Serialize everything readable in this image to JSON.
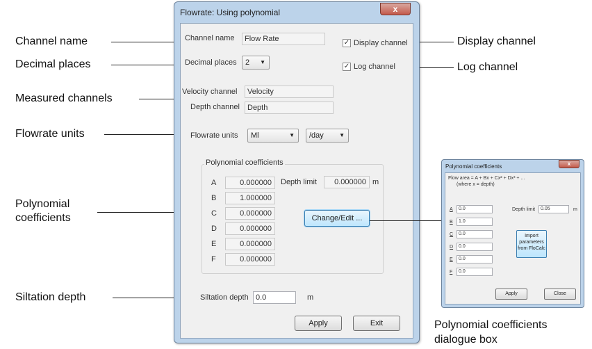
{
  "callouts": {
    "channel_name": "Channel name",
    "decimal_places": "Decimal places",
    "measured_channels": "Measured channels",
    "flowrate_units": "Flowrate units",
    "polynomial_coefficients": [
      "Polynomial",
      "coefficients"
    ],
    "siltation_depth": "Siltation depth",
    "display_channel": "Display channel",
    "log_channel": "Log channel",
    "dialogue_caption": [
      "Polynomial coefficients",
      "dialogue box"
    ]
  },
  "main_dialog": {
    "title": "Flowrate: Using polynomial",
    "close_label": "x",
    "channel_name_label": "Channel name",
    "channel_name_value": "Flow Rate",
    "decimal_places_label": "Decimal places",
    "decimal_places_value": "2",
    "display_channel_label": "Display channel",
    "display_channel_checked": true,
    "log_channel_label": "Log channel",
    "log_channel_checked": true,
    "velocity_channel_label": "Velocity channel",
    "velocity_channel_value": "Velocity",
    "depth_channel_label": "Depth channel",
    "depth_channel_value": "Depth",
    "flowrate_units_label": "Flowrate units",
    "flowrate_unit_value": "Ml",
    "flowrate_period_value": "/day",
    "poly_group_label": "Polynomial coefficients",
    "coefficients": [
      {
        "letter": "A",
        "value": "0.000000"
      },
      {
        "letter": "B",
        "value": "1.000000"
      },
      {
        "letter": "C",
        "value": "0.000000"
      },
      {
        "letter": "D",
        "value": "0.000000"
      },
      {
        "letter": "E",
        "value": "0.000000"
      },
      {
        "letter": "F",
        "value": "0.000000"
      }
    ],
    "depth_limit_label": "Depth limit",
    "depth_limit_value": "0.000000",
    "depth_limit_unit": "m",
    "change_edit_label": "Change/Edit ...",
    "siltation_depth_label": "Siltation depth",
    "siltation_depth_value": "0.0",
    "siltation_unit": "m",
    "apply_label": "Apply",
    "exit_label": "Exit"
  },
  "coeff_dialog": {
    "title": "Polynomial coefficients",
    "close_label": "x",
    "formula_line1": "Flow area = A + Bx + Cx² + Dx³ + ...",
    "formula_line2": "(where x = depth)",
    "coefficients": [
      {
        "letter": "A",
        "value": "0.0"
      },
      {
        "letter": "B",
        "value": "1.0"
      },
      {
        "letter": "C",
        "value": "0.0"
      },
      {
        "letter": "D",
        "value": "0.0"
      },
      {
        "letter": "E",
        "value": "0.0"
      },
      {
        "letter": "F",
        "value": "0.0"
      }
    ],
    "depth_limit_label": "Depth limit",
    "depth_limit_value": "0.05",
    "depth_limit_unit": "m",
    "import_label": "Import parameters from FloCalc",
    "apply_label": "Apply",
    "close_button_label": "Close"
  }
}
